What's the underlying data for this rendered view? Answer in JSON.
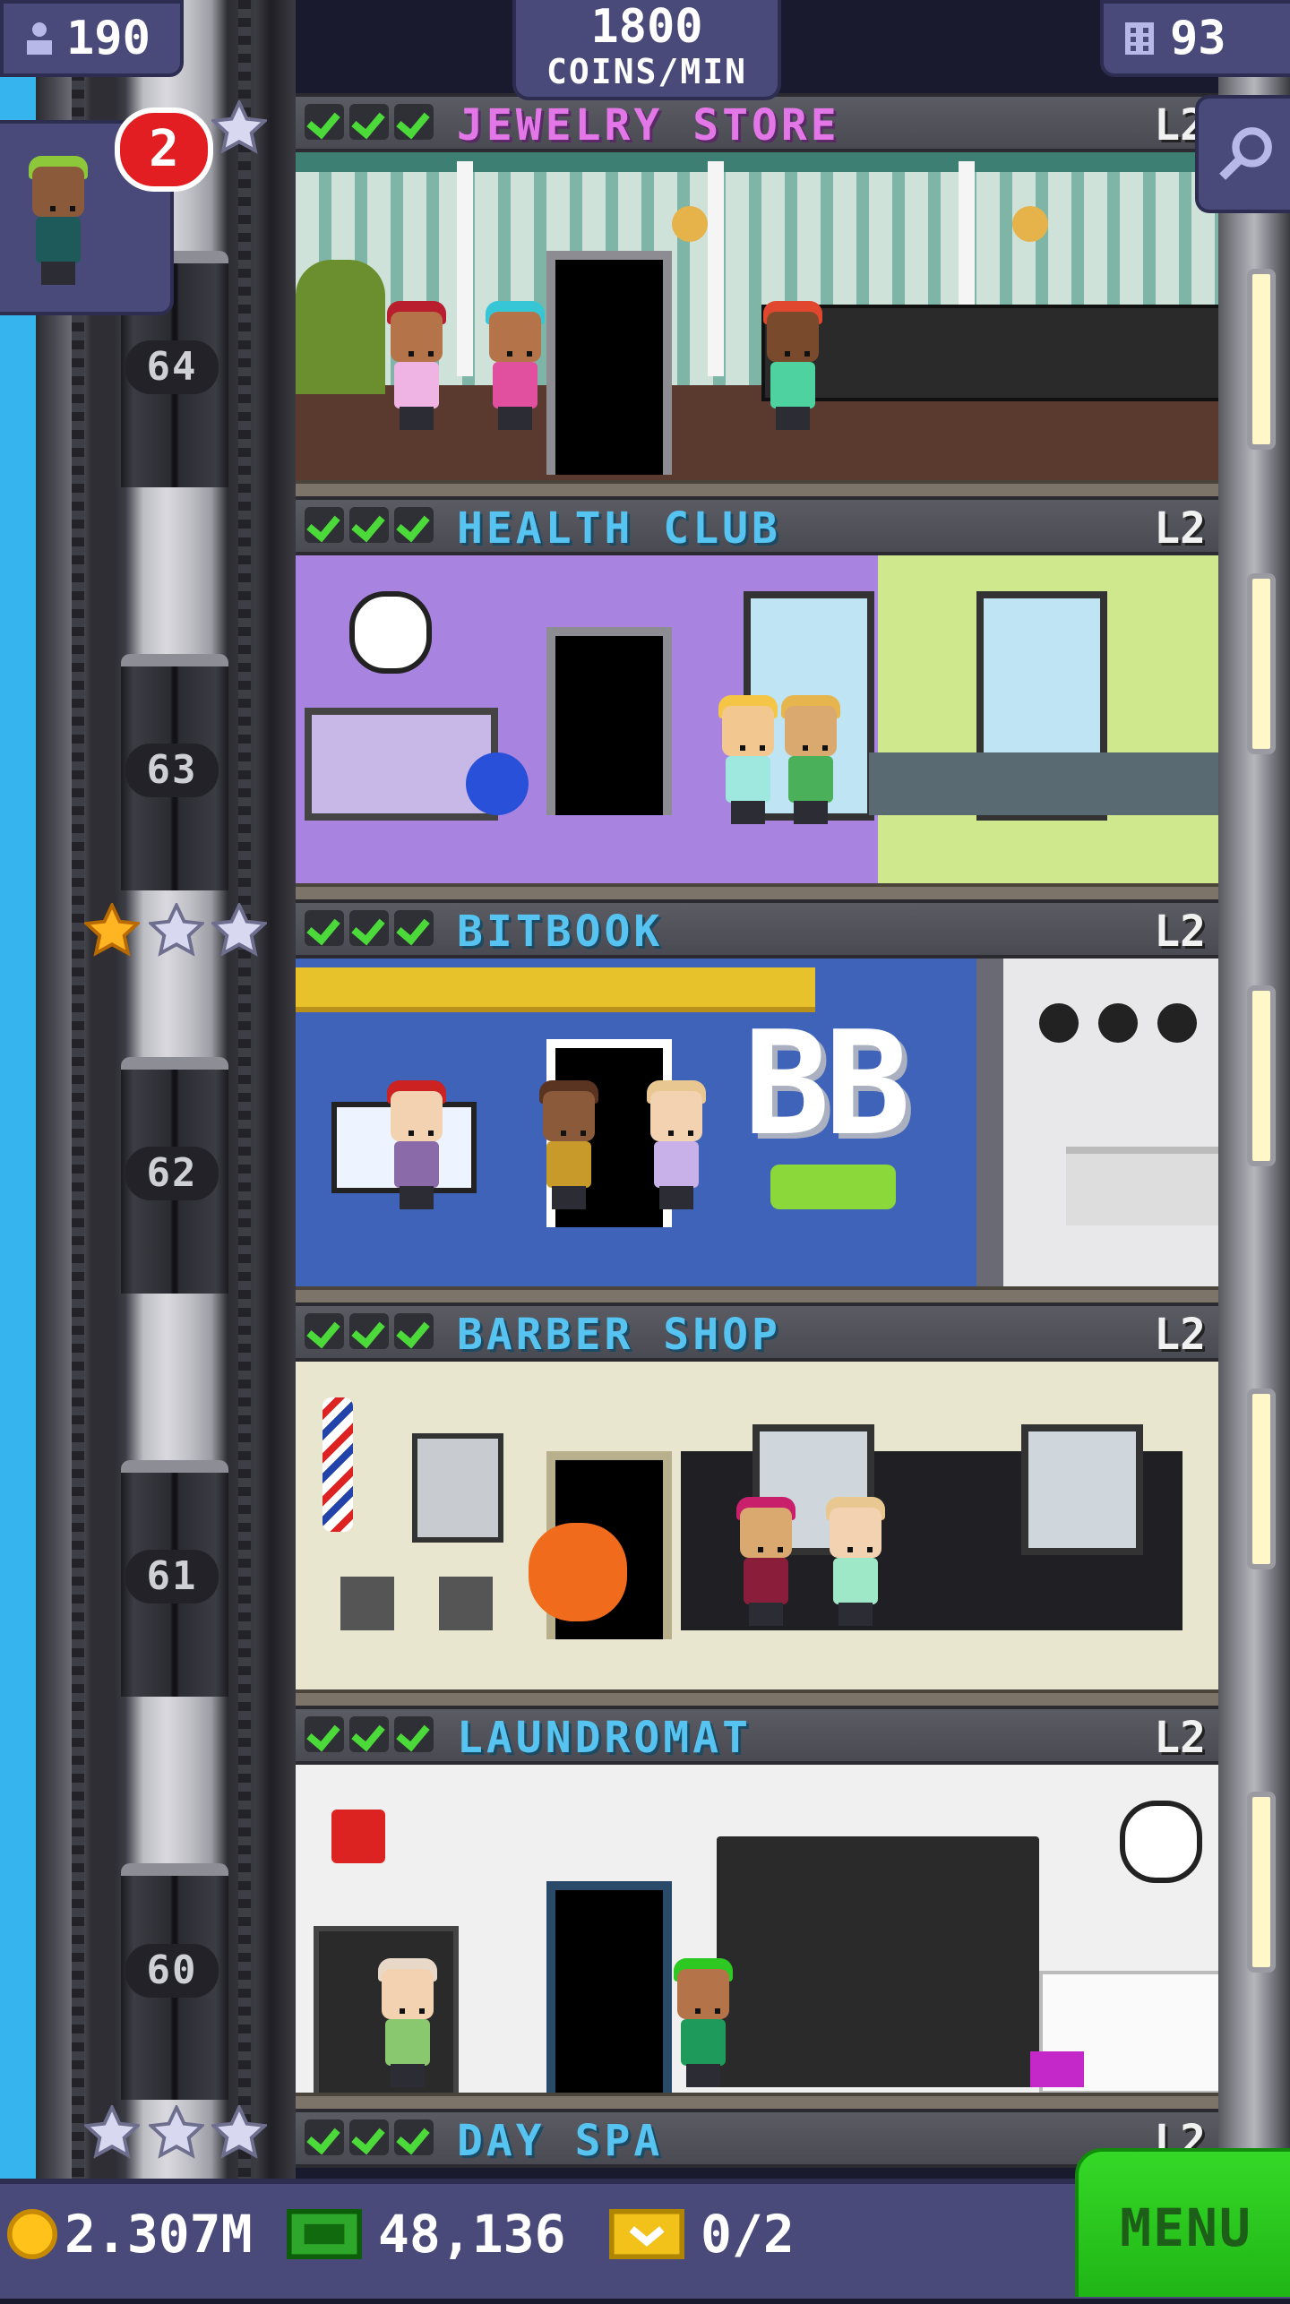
{
  "stats": {
    "population": "190",
    "coins_per_min_value": "1800",
    "coins_per_min_label": "COINS/MIN",
    "floor_count": "93"
  },
  "elevator": {
    "rider_badge": "2",
    "floor_numbers": [
      "64",
      "63",
      "62",
      "61",
      "60"
    ]
  },
  "floors": [
    {
      "name": "JEWELRY STORE",
      "level": "L2",
      "name_color": "#e377e8"
    },
    {
      "name": "HEALTH CLUB",
      "level": "L2",
      "name_color": "#56c3f0"
    },
    {
      "name": "BITBOOK",
      "level": "L2",
      "name_color": "#56c3f0"
    },
    {
      "name": "BARBER SHOP",
      "level": "L2",
      "name_color": "#56c3f0"
    },
    {
      "name": "LAUNDROMAT",
      "level": "L2",
      "name_color": "#56c3f0"
    },
    {
      "name": "DAY SPA",
      "level": "L2",
      "name_color": "#56c3f0"
    }
  ],
  "bitbook_sign": "BB",
  "bottom": {
    "coins": "2.307M",
    "bux": "48,136",
    "tickets": "0/2",
    "menu_label": "MENU"
  },
  "colors": {
    "ui_panel": "#4a4a7a",
    "menu_green": "#2ec822",
    "check_green": "#4cd93a",
    "badge_red": "#e21e23",
    "sky": "#36b4ee"
  },
  "icons": [
    "person-icon",
    "building-icon",
    "search-icon",
    "star-icon",
    "coin-icon",
    "bux-icon",
    "ticket-icon",
    "checkmark-icon"
  ]
}
